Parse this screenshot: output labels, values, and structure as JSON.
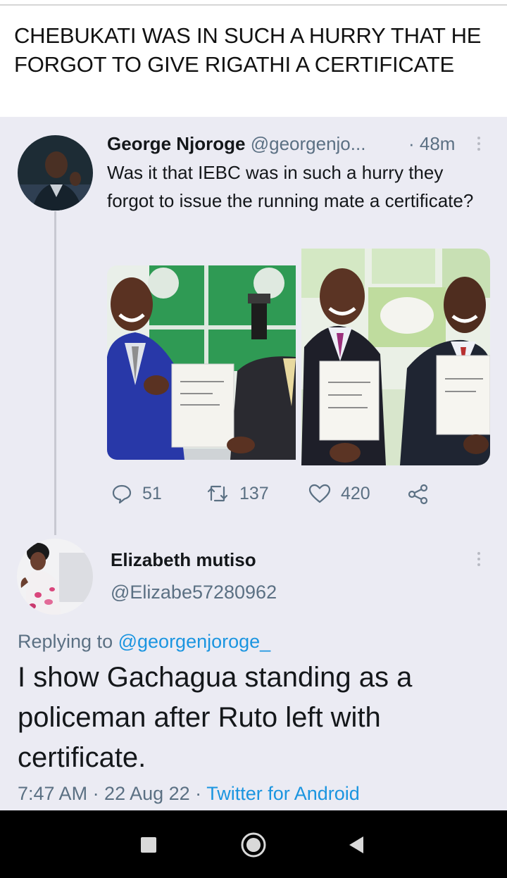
{
  "caption": "CHEBUKATI WAS IN SUCH A HURRY THAT HE FORGOT TO GIVE RIGATHI A CERTIFICATE",
  "tweet": {
    "name": "George Njoroge",
    "handle": "@georgenjo...",
    "time": "· 48m",
    "text": "Was it that IEBC was in such a hurry they forgot to issue the running mate a certificate?",
    "replies": "51",
    "retweets": "137",
    "likes": "420",
    "colors": {
      "link": "#1b95e0",
      "muted": "#5b7083",
      "background": "#ebebf3"
    }
  },
  "reply": {
    "name": "Elizabeth mutiso",
    "handle": "@Elizabe57280962",
    "replying_prefix": "Replying to",
    "replying_mention": "@georgenjoroge_",
    "text": "I show Gachagua standing as a policeman after Ruto left with certificate.",
    "timestamp": "7:47 AM · 22 Aug 22 · ",
    "source": "Twitter for Android"
  },
  "icons": {
    "reply": "comment-icon",
    "retweet": "retweet-icon",
    "like": "heart-icon",
    "share": "share-icon",
    "more": "more-vertical-icon",
    "nav_recents": "square-recents-icon",
    "nav_home": "circle-home-icon",
    "nav_back": "triangle-back-icon"
  }
}
